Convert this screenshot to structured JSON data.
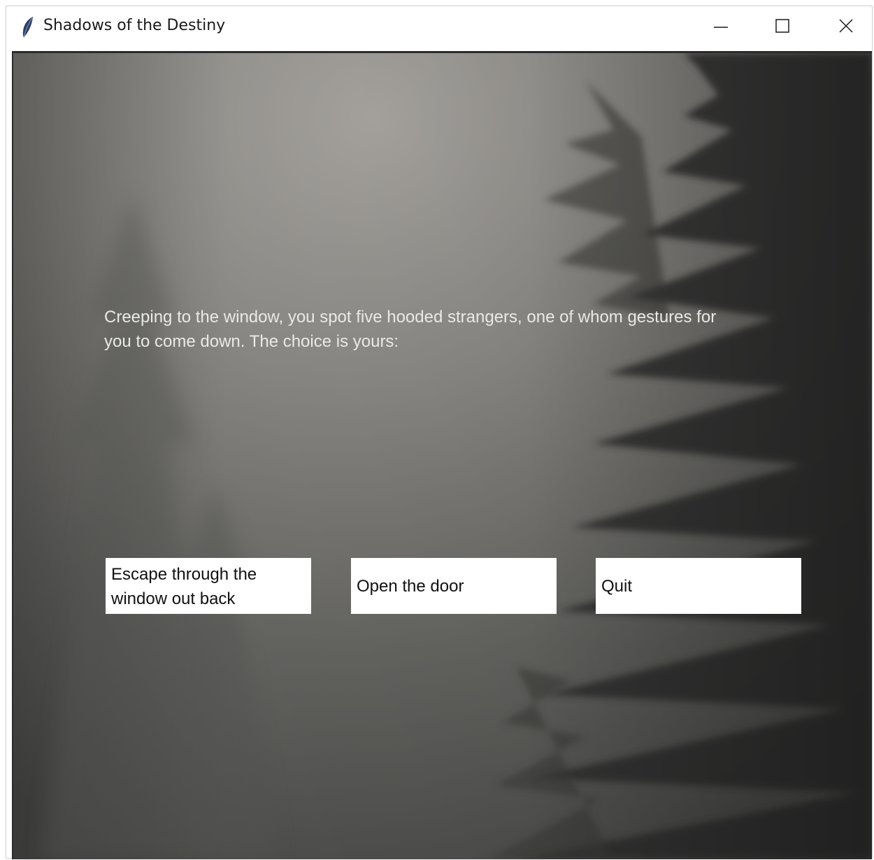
{
  "window": {
    "title": "Shadows of the Destiny",
    "app_icon": "feather-icon",
    "controls": {
      "minimize_icon": "minimize-icon",
      "maximize_icon": "maximize-icon",
      "close_icon": "close-icon"
    }
  },
  "scene": {
    "background": "foggy-forest-image",
    "narration": "Creeping to the window, you spot five hooded strangers, one of whom gestures for you to come down. The choice is yours:",
    "choices": [
      {
        "label": "Escape through the window out back"
      },
      {
        "label": "Open the door"
      },
      {
        "label": "Quit"
      }
    ]
  },
  "colors": {
    "narration_text": "#e9e9e6",
    "button_bg": "#ffffff",
    "button_text": "#111111",
    "fog_light": "#a8a6a2",
    "fog_dark": "#3a3a38"
  }
}
